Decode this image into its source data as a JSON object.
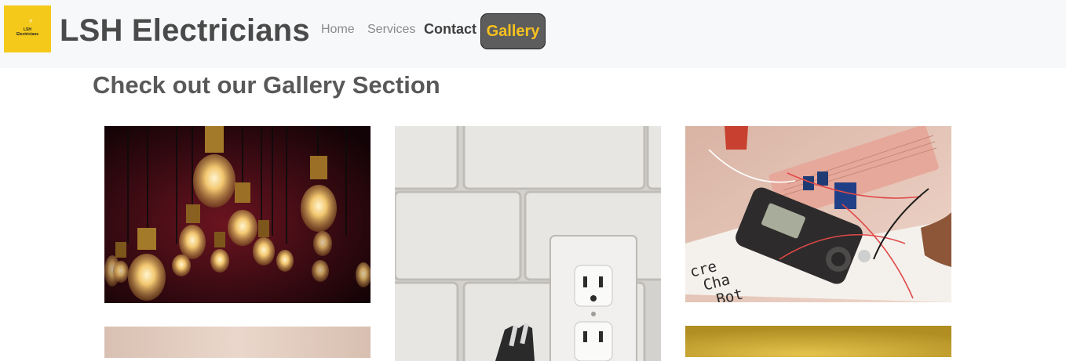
{
  "header": {
    "logo_text": "LSH Electricians",
    "logo_mini_line1": "LSH",
    "logo_mini_line2": "Electricians",
    "brand": "LSH Electricians",
    "nav": {
      "home": "Home",
      "services": "Services",
      "contact": "Contact",
      "gallery": "Gallery"
    }
  },
  "main": {
    "heading": "Check out our Gallery Section",
    "multimeter_text": "cre\nCha\nBot"
  },
  "colors": {
    "accent": "#f7c21e",
    "navbar_bg": "#f7f8fa",
    "heading": "#595959",
    "gallery_button_bg": "#5d5d5d"
  },
  "icons": {
    "logo": "lightning-bolt-icon"
  }
}
